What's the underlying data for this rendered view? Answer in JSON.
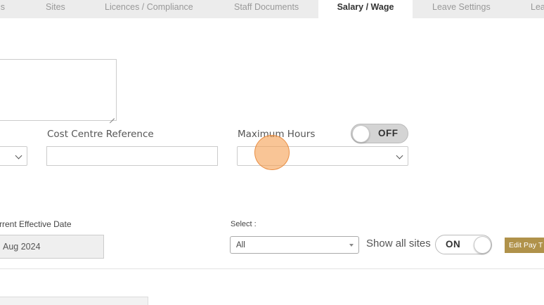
{
  "tabs": [
    {
      "label": "ls"
    },
    {
      "label": "Sites"
    },
    {
      "label": "Licences / Compliance"
    },
    {
      "label": "Staff Documents"
    },
    {
      "label": "Salary / Wage",
      "active": true
    },
    {
      "label": "Leave Settings"
    },
    {
      "label": "Lea"
    }
  ],
  "form": {
    "cost_centre_label": "Cost Centre Reference",
    "cost_centre_value": "",
    "maximum_hours_label": "Maximum Hours",
    "maximum_hours_toggle": "OFF",
    "maximum_hours_value": ""
  },
  "pay": {
    "effective_date_label": "rrent Effective Date",
    "effective_date_value": "Aug 2024",
    "select_label": "Select :",
    "select_value": "All",
    "show_all_sites_label": "Show all sites",
    "show_all_sites_toggle": "ON",
    "edit_button_label": "Edit Pay T"
  },
  "colors": {
    "tab_bar": "#ececec",
    "edit_button": "#b0924a",
    "cursor_highlight": "#f59e50"
  }
}
